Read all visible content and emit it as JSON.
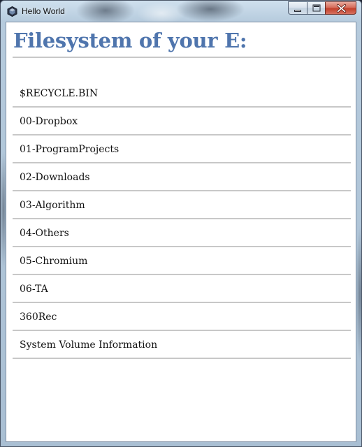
{
  "window": {
    "title": "Hello World",
    "app_icon": "hexagon-app-icon",
    "controls": {
      "minimize": "minimize-icon",
      "maximize": "maximize-icon",
      "close": "close-icon",
      "close_color": "#c2402b"
    }
  },
  "page": {
    "heading": "Filesystem of your E:",
    "heading_color": "#4f75ad",
    "divider_color": "#c8c8c8"
  },
  "directories": [
    {
      "name": "$RECYCLE.BIN"
    },
    {
      "name": "00-Dropbox"
    },
    {
      "name": "01-ProgramProjects"
    },
    {
      "name": "02-Downloads"
    },
    {
      "name": "03-Algorithm"
    },
    {
      "name": "04-Others"
    },
    {
      "name": "05-Chromium"
    },
    {
      "name": "06-TA"
    },
    {
      "name": "360Rec"
    },
    {
      "name": "System Volume Information"
    }
  ]
}
